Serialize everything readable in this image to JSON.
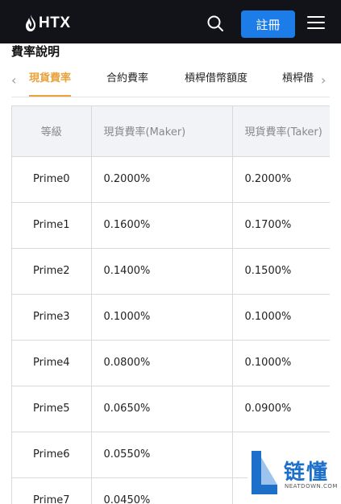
{
  "header": {
    "logo_text": "HTX",
    "register_label": "註冊"
  },
  "page": {
    "section_title": "費率說明"
  },
  "tabs": [
    {
      "label": "現貨費率",
      "active": true
    },
    {
      "label": "合約費率",
      "active": false
    },
    {
      "label": "槓桿借幣額度",
      "active": false
    },
    {
      "label": "槓桿借",
      "active": false
    }
  ],
  "table": {
    "headers": [
      "等級",
      "現貨費率(Maker)",
      "現貨費率(Taker)"
    ],
    "rows": [
      [
        "Prime0",
        "0.2000%",
        "0.2000%"
      ],
      [
        "Prime1",
        "0.1600%",
        "0.1700%"
      ],
      [
        "Prime2",
        "0.1400%",
        "0.1500%"
      ],
      [
        "Prime3",
        "0.1000%",
        "0.1000%"
      ],
      [
        "Prime4",
        "0.0800%",
        "0.1000%"
      ],
      [
        "Prime5",
        "0.0650%",
        "0.0900%"
      ],
      [
        "Prime6",
        "0.0550%",
        ""
      ],
      [
        "Prime7",
        "0.0450%",
        ""
      ]
    ]
  },
  "watermark": {
    "text": "链懂",
    "subtext": "NEATDOWN.COM"
  },
  "colors": {
    "accent": "#e8a33d",
    "brand_blue": "#1c7ce8",
    "header_bg": "#111318"
  }
}
